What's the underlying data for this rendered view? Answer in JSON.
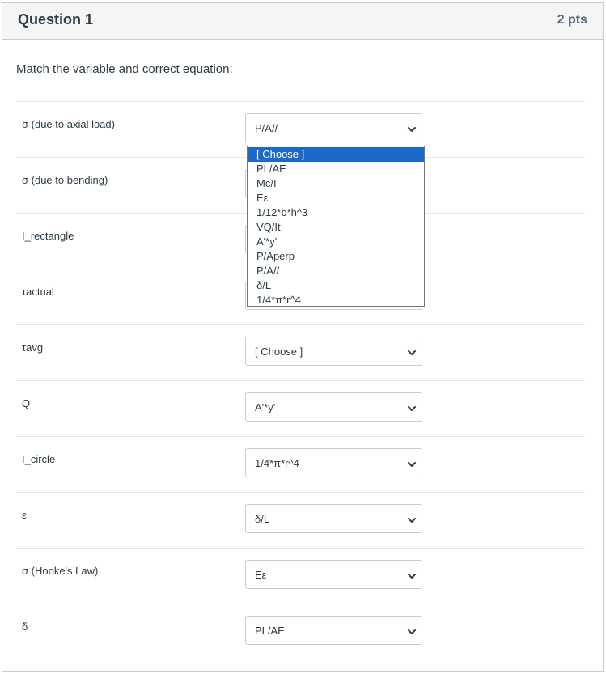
{
  "question": {
    "title": "Question 1",
    "points": "2 pts",
    "instruction": "Match the variable and correct equation:"
  },
  "rows": [
    {
      "label": "σ (due to axial load)",
      "selected": "P/A//"
    },
    {
      "label": "σ (due to bending)",
      "selected": ""
    },
    {
      "label": "I_rectangle",
      "selected": ""
    },
    {
      "label": "τactual",
      "selected": ""
    },
    {
      "label": "τavg",
      "selected": "[ Choose ]"
    },
    {
      "label": "Q",
      "selected": "A'*y'"
    },
    {
      "label": "I_circle",
      "selected": "1/4*π*r^4"
    },
    {
      "label": "ε",
      "selected": "δ/L"
    },
    {
      "label": "σ (Hooke's Law)",
      "selected": "Eε"
    },
    {
      "label": "δ",
      "selected": "PL/AE"
    }
  ],
  "dropdown": {
    "highlighted": "[ Choose ]",
    "options": [
      "[ Choose ]",
      "PL/AE",
      "Mc/I",
      "Eε",
      "1/12*b*h^3",
      "VQ/It",
      "A'*y'",
      "P/Aperp",
      "P/A//",
      "δ/L",
      "1/4*π*r^4"
    ]
  },
  "icons": {
    "select_arrow": "chevron-down-icon"
  },
  "colors": {
    "highlight": "#1b6ac9",
    "header_bg": "#f5f5f5",
    "text": "#2d3b45"
  }
}
